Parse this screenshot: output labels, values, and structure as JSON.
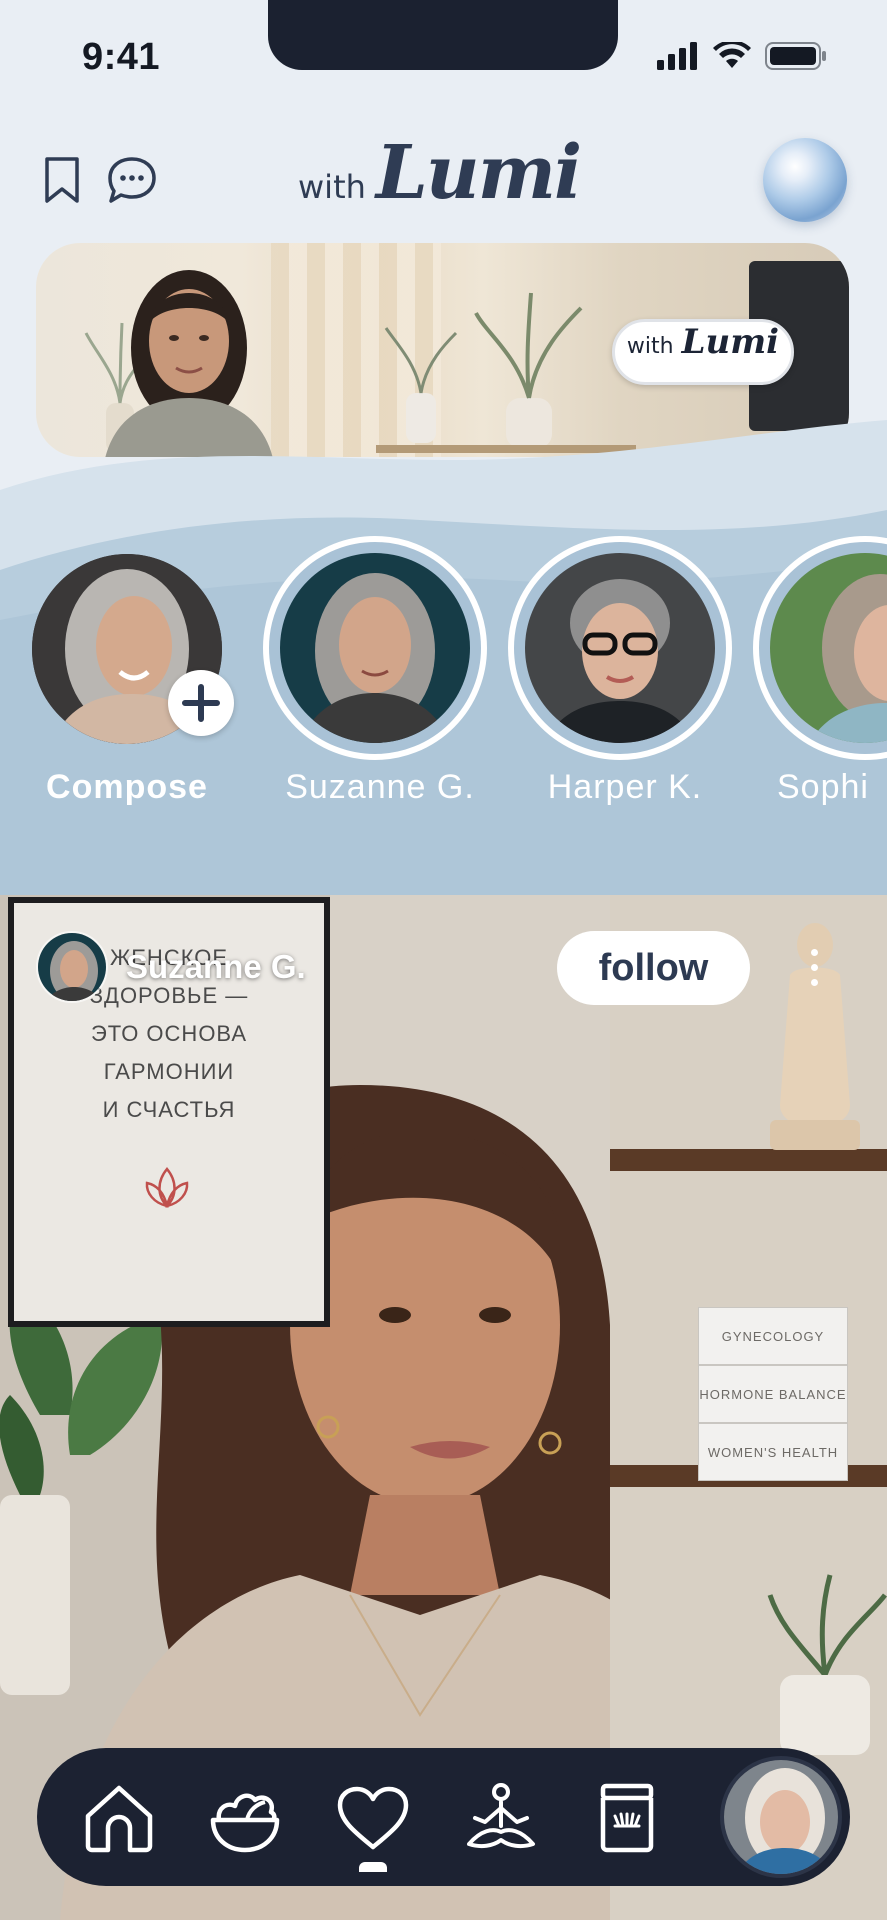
{
  "status_bar": {
    "time": "9:41"
  },
  "header": {
    "logo_with": "with",
    "logo_name": "Lumi",
    "icons": [
      "bookmark-icon",
      "chat-bubble-icon",
      "assistant-orb-icon"
    ]
  },
  "hero": {
    "badge_with": "with",
    "badge_name": "Lumi"
  },
  "stories": [
    {
      "label": "Compose",
      "icon": "plus-icon"
    },
    {
      "label": "Suzanne G."
    },
    {
      "label": "Harper K."
    },
    {
      "label": "Sophi"
    }
  ],
  "post": {
    "author": "Suzanne G.",
    "follow_label": "follow",
    "poster_lines": [
      "ЖЕНСКОЕ",
      "ЗДОРОВЬЕ —",
      "ЭТО ОСНОВА",
      "ГАРМОНИИ",
      "И СЧАСТЬЯ"
    ],
    "books": [
      "GYNECOLOGY",
      "HORMONE BALANCE",
      "WOMEN'S HEALTH"
    ]
  },
  "bottom_nav": {
    "items": [
      "home-icon",
      "salad-bowl-icon",
      "heart-icon",
      "meditation-icon",
      "jar-icon"
    ],
    "active_index": 2
  },
  "colors": {
    "dark": "#1c2232",
    "accent_text": "#2d3a52",
    "wave": "#aec6d8",
    "background": "#e9eef4"
  }
}
